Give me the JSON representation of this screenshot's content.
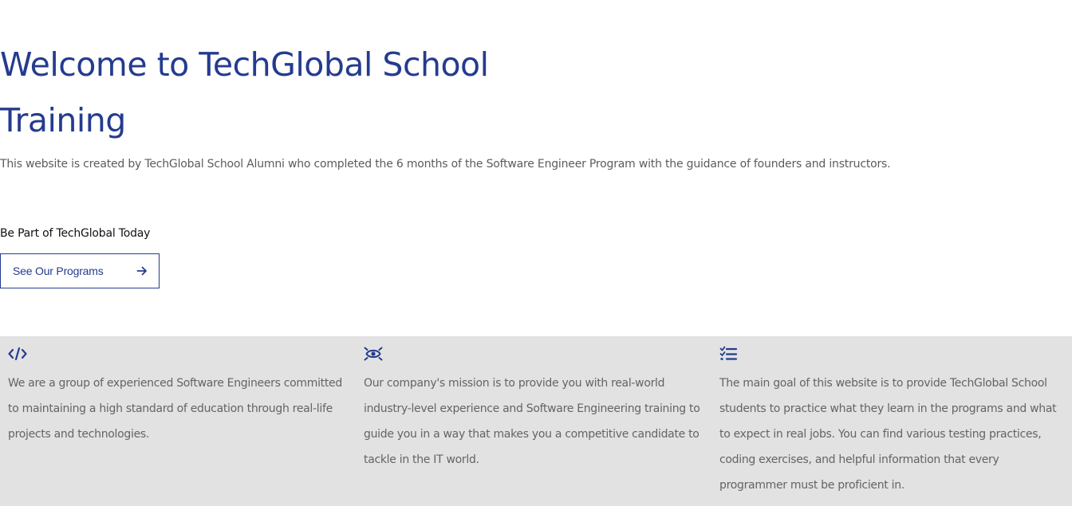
{
  "hero": {
    "title": "Welcome to TechGlobal School Training",
    "description": "This website is created by TechGlobal School Alumni who completed the 6 months of the Software Engineer Program with the guidance of founders and instructors.",
    "cta_label": "Be Part of TechGlobal Today",
    "cta_button": "See Our Programs",
    "cta_icon": "arrow-right-icon"
  },
  "colors": {
    "brand": "#243b8f",
    "body_text": "#646464",
    "features_background": "#e2e2e2"
  },
  "features": [
    {
      "icon": "code-icon",
      "text": "We are a group of experienced Software Engineers committed to maintaining a high standard of education through real-life projects and technologies."
    },
    {
      "icon": "eye-target-icon",
      "text": "Our company's mission is to provide you with real-world industry-level experience and Software Engineering training to guide you in a way that makes you a competitive candidate to tackle in the IT world."
    },
    {
      "icon": "checklist-icon",
      "text": "The main goal of this website is to provide TechGlobal School students to practice what they learn in the programs and what to expect in real jobs. You can find various testing practices, coding exercises, and helpful information that every programmer must be proficient in."
    }
  ]
}
